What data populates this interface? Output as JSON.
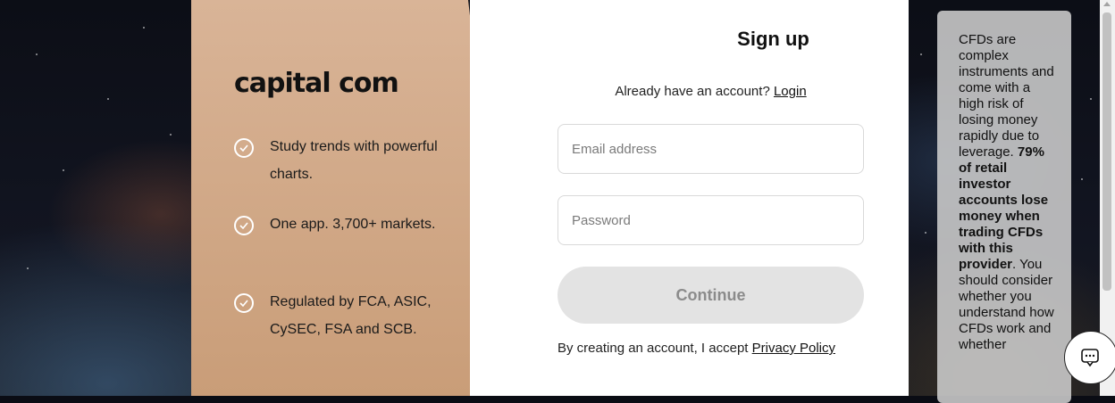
{
  "brand": {
    "logo_text": "capital com"
  },
  "features": [
    {
      "text": "Study trends with powerful charts."
    },
    {
      "text": "One app. 3,700+ markets."
    },
    {
      "text": "Regulated by FCA, ASIC, CySEC, FSA and SCB."
    }
  ],
  "form": {
    "title": "Sign up",
    "already_text": "Already have an account?",
    "login_link": "Login",
    "email_placeholder": "Email address",
    "email_value": "",
    "password_placeholder": "Password",
    "password_value": "",
    "continue_label": "Continue",
    "terms_text": "By creating an account, I accept",
    "privacy_link": "Privacy Policy"
  },
  "risk_warning": {
    "part1": "CFDs are complex instruments and come with a high risk of losing money rapidly due to leverage.",
    "part2_bold": "79% of retail investor accounts lose money when trading CFDs with this provider",
    "part3": ". You should consider whether you understand how CFDs work and whether"
  },
  "colors": {
    "promo_bg": "#c99d78",
    "button_bg": "#e3e3e3",
    "button_text": "#8b8b8b"
  },
  "icons": {
    "feature_icon": "check-circle-icon",
    "chat_icon": "chat-bubble-icon"
  }
}
